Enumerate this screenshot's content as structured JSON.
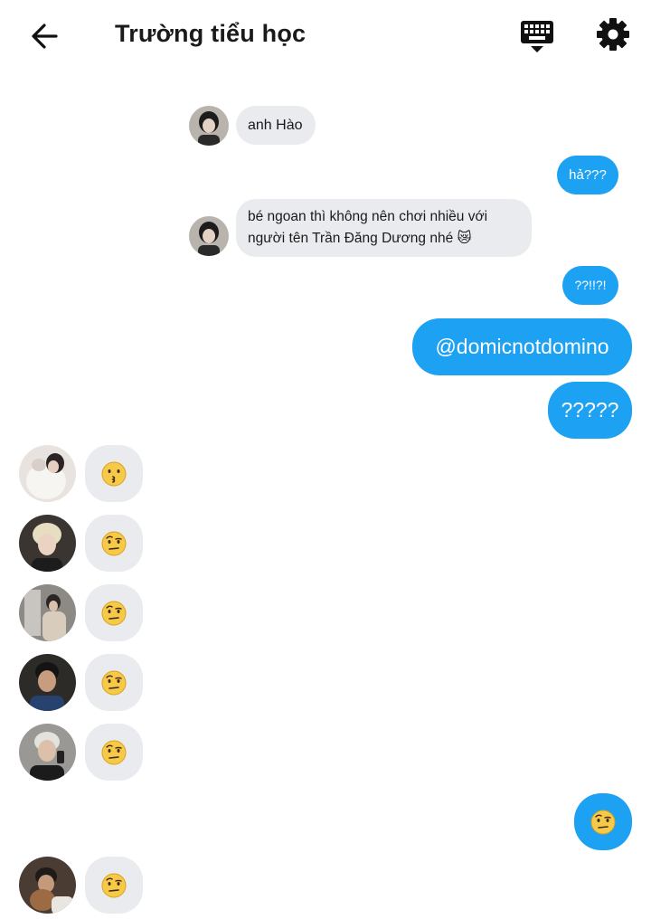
{
  "header": {
    "title": "Trường tiểu học",
    "back_icon": "arrow-left-icon",
    "keyboard_icon": "keyboard-hide-icon",
    "settings_icon": "gear-icon"
  },
  "colors": {
    "outgoing_bubble": "#1da1f2",
    "incoming_bubble": "#e9ebee",
    "emoji_yellow": "#f7c948"
  },
  "messages": [
    {
      "direction": "in",
      "text": "anh Hào"
    },
    {
      "direction": "out",
      "text": "hả???"
    },
    {
      "direction": "in",
      "text": "bé ngoan thì không nên chơi nhiều với người tên Trần Đăng Dương nhé 😿"
    },
    {
      "direction": "out",
      "text": "??!!?!"
    },
    {
      "direction": "out",
      "text": "@domicnotdomino"
    },
    {
      "direction": "out",
      "text": "?????"
    },
    {
      "direction": "in",
      "emoji": "kissing-face-icon"
    },
    {
      "direction": "in",
      "emoji": "raised-eyebrow-face-icon"
    },
    {
      "direction": "in",
      "emoji": "raised-eyebrow-face-icon"
    },
    {
      "direction": "in",
      "emoji": "raised-eyebrow-face-icon"
    },
    {
      "direction": "in",
      "emoji": "raised-eyebrow-face-icon"
    },
    {
      "direction": "out",
      "emoji": "raised-eyebrow-face-icon"
    },
    {
      "direction": "in",
      "emoji": "raised-eyebrow-face-icon"
    }
  ]
}
